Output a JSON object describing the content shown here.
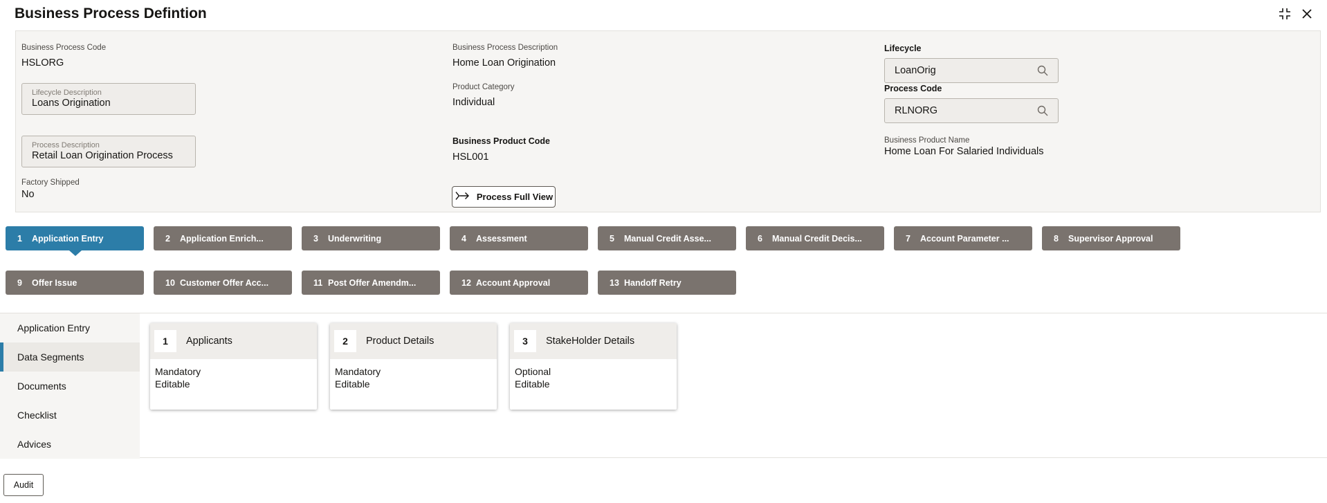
{
  "header": {
    "title": "Business Process Defintion"
  },
  "fields": {
    "bp_code_label": "Business Process Code",
    "bp_code_value": "HSLORG",
    "lifecycle_desc_label": "Lifecycle Description",
    "lifecycle_desc_value": "Loans Origination",
    "process_desc_label": "Process Description",
    "process_desc_value": "Retail Loan Origination Process",
    "factory_label": "Factory Shipped",
    "factory_value": "No",
    "bp_desc_label": "Business Process Description",
    "bp_desc_value": "Home Loan Origination",
    "product_cat_label": "Product Category",
    "product_cat_value": "Individual",
    "bprod_code_label": "Business Product Code",
    "bprod_code_value": "HSL001",
    "lifecycle_label": "Lifecycle",
    "lifecycle_value": "LoanOrig",
    "process_code_label": "Process Code",
    "process_code_value": "RLNORG",
    "bprod_name_label": "Business Product Name",
    "bprod_name_value": "Home Loan For Salaried Individuals"
  },
  "buttons": {
    "process_full_view": "Process Full View",
    "audit": "Audit"
  },
  "stages": [
    {
      "num": "1",
      "label": "Application Entry"
    },
    {
      "num": "2",
      "label": "Application Enrich..."
    },
    {
      "num": "3",
      "label": "Underwriting"
    },
    {
      "num": "4",
      "label": "Assessment"
    },
    {
      "num": "5",
      "label": "Manual Credit Asse..."
    },
    {
      "num": "6",
      "label": "Manual Credit Decis..."
    },
    {
      "num": "7",
      "label": "Account Parameter ..."
    },
    {
      "num": "8",
      "label": "Supervisor Approval"
    },
    {
      "num": "9",
      "label": "Offer Issue"
    },
    {
      "num": "10",
      "label": "Customer Offer Acc..."
    },
    {
      "num": "11",
      "label": "Post Offer Amendm..."
    },
    {
      "num": "12",
      "label": "Account Approval"
    },
    {
      "num": "13",
      "label": "Handoff Retry"
    }
  ],
  "sidebar": [
    {
      "label": "Application Entry"
    },
    {
      "label": "Data Segments"
    },
    {
      "label": "Documents"
    },
    {
      "label": "Checklist"
    },
    {
      "label": "Advices"
    }
  ],
  "cards": [
    {
      "num": "1",
      "title": "Applicants",
      "line1": "Mandatory",
      "line2": "Editable"
    },
    {
      "num": "2",
      "title": "Product Details",
      "line1": "Mandatory",
      "line2": "Editable"
    },
    {
      "num": "3",
      "title": "StakeHolder Details",
      "line1": "Optional",
      "line2": "Editable"
    }
  ],
  "colors": {
    "active_stage": "#2c7da8",
    "stage": "#7a736e"
  }
}
